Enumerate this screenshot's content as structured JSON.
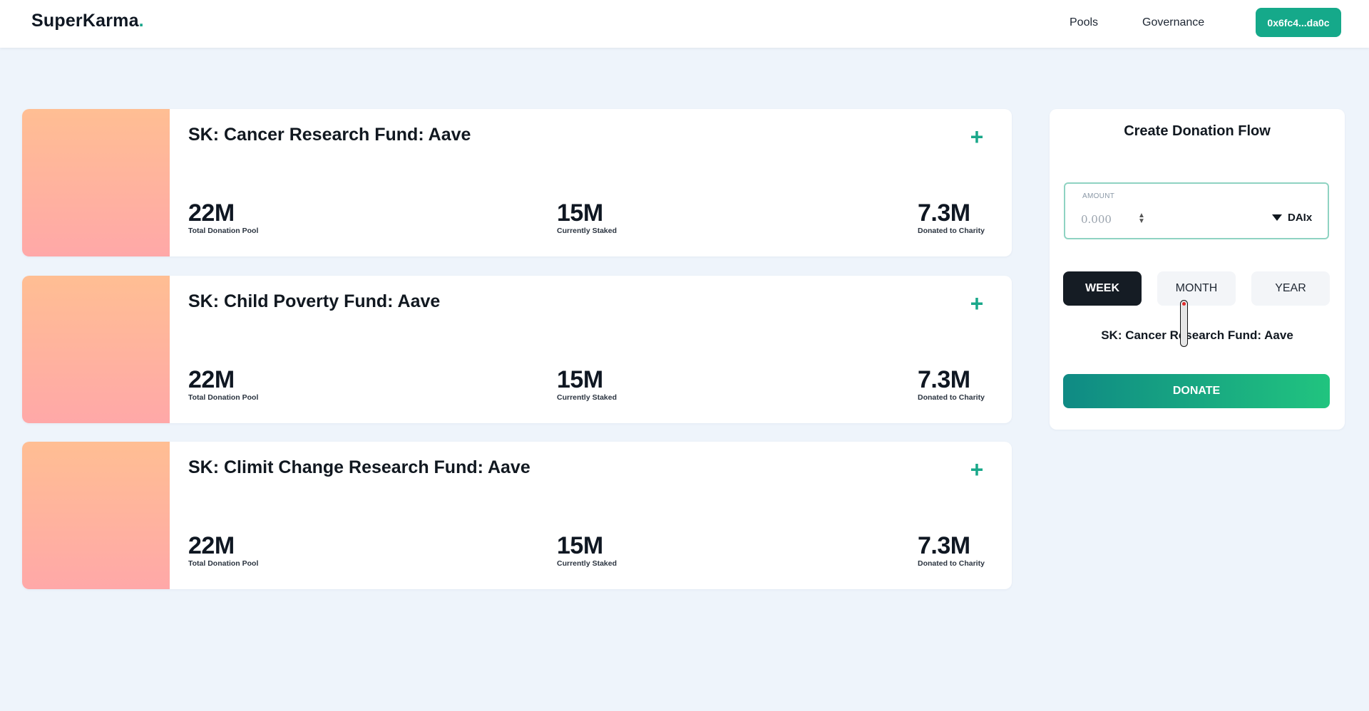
{
  "header": {
    "logo_text": "SuperKarma",
    "logo_dot": ".",
    "nav": [
      "Pools",
      "Governance"
    ],
    "wallet_address": "0x6fc4...da0c"
  },
  "pools": [
    {
      "title": "SK: Cancer Research Fund: Aave",
      "stats": [
        {
          "value": "22M",
          "label": "Total Donation Pool"
        },
        {
          "value": "15M",
          "label": "Currently Staked"
        },
        {
          "value": "7.3M",
          "label": "Donated to Charity"
        }
      ]
    },
    {
      "title": "SK: Child Poverty Fund: Aave",
      "stats": [
        {
          "value": "22M",
          "label": "Total Donation Pool"
        },
        {
          "value": "15M",
          "label": "Currently Staked"
        },
        {
          "value": "7.3M",
          "label": "Donated to Charity"
        }
      ]
    },
    {
      "title": "SK: Climit Change Research Fund: Aave",
      "stats": [
        {
          "value": "22M",
          "label": "Total Donation Pool"
        },
        {
          "value": "15M",
          "label": "Currently Staked"
        },
        {
          "value": "7.3M",
          "label": "Donated to Charity"
        }
      ]
    }
  ],
  "add_icon": "plus-icon",
  "colors": {
    "accent": "#15a98a",
    "background": "#eef4fb",
    "dark": "#151c24",
    "thumb_top": "#ffbe93",
    "thumb_bottom": "#ffa8a8",
    "donate_gradient_start": "#0f8a84",
    "donate_gradient_end": "#21c47f"
  },
  "donation_form": {
    "title": "Create Donation Flow",
    "amount_label": "AMOUNT",
    "amount_placeholder": "0.000",
    "currency": "DAIx",
    "periods": [
      "WEEK",
      "MONTH",
      "YEAR"
    ],
    "selected_period": "WEEK",
    "selected_pool": "SK: Cancer Research Fund: Aave",
    "submit_label": "DONATE"
  }
}
